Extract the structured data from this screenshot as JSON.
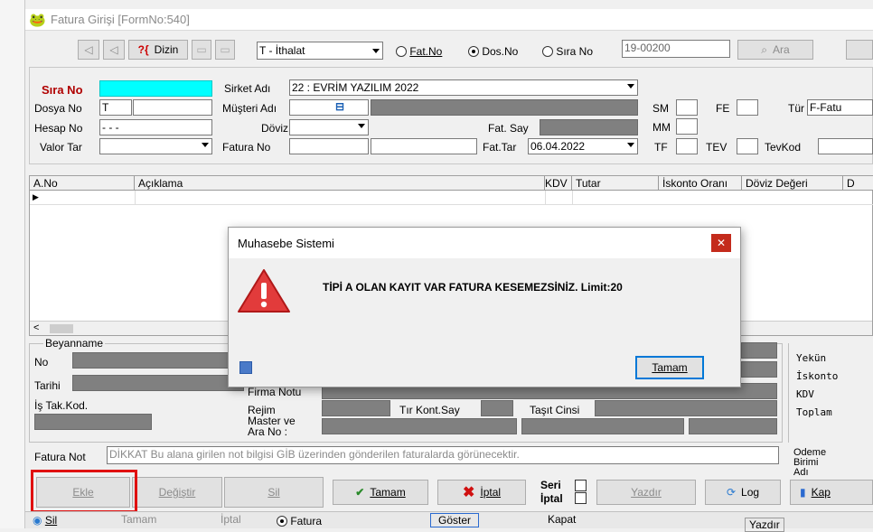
{
  "window": {
    "title": "Fatura Girişi [FormNo:540]"
  },
  "toolbar": {
    "dizin": "Dizin",
    "type_select": "T - İthalat",
    "radio_fatno": "Fat.No",
    "radio_dosno": "Dos.No",
    "radio_sirano": "Sıra No",
    "search_value": "19-00200",
    "search_button": "Ara"
  },
  "form": {
    "sira_no_label": "Sıra No",
    "sirket_adi_label": "Sirket Adı",
    "sirket_adi_value": "22 : EVRİM YAZILIM 2022",
    "dosya_no_label": "Dosya No",
    "dosya_no_value": "T",
    "musteri_adi_label": "Müşteri Adı",
    "hesap_no_label": "Hesap No",
    "hesap_no_value": "- - -",
    "doviz_label": "Döviz",
    "fat_say_label": "Fat. Say",
    "valor_tar_label": "Valor Tar",
    "fatura_no_label": "Fatura No",
    "fat_tar_label": "Fat.Tar",
    "fat_tar_value": "06.04.2022",
    "sm_label": "SM",
    "fe_label": "FE",
    "mm_label": "MM",
    "tf_label": "TF",
    "tev_label": "TEV",
    "tevkod_label": "TevKod",
    "tur_label": "Tür",
    "tur_value": "F-Fatu"
  },
  "grid": {
    "columns": [
      "A.No",
      "Açıklama",
      "KDV",
      "Tutar",
      "İskonto Oranı",
      "Döviz Değeri",
      "D"
    ]
  },
  "beyanname": {
    "title": "Beyanname",
    "no_label": "No",
    "tarihi_label": "Tarihi",
    "is_tak_label": "İş Tak.Kod.",
    "firma_notu_label": "Firma Notu",
    "rejim_label": "Rejim",
    "tir_kont_label": "Tır Kont.Say",
    "tasit_label": "Taşıt Cinsi",
    "master_label": "Master ve\nAra No :"
  },
  "totals": {
    "yekun": "Yekün",
    "iskonto": "İskonto",
    "kdv": "KDV",
    "toplam": "Toplam",
    "odeme": "Ödeme\nBirimi\nAdı"
  },
  "fatura_not": {
    "label": "Fatura Not",
    "placeholder": "DİKKAT Bu alana girilen not bilgisi GİB üzerinden gönderilen faturalarda görünecektir."
  },
  "buttons": {
    "ekle": "Ekle",
    "degistir": "Değiştir",
    "sil": "Sil",
    "tamam": "Tamam",
    "iptal": "İptal",
    "seri": "Seri",
    "iptal2": "İptal",
    "yazdir": "Yazdır",
    "log": "Log",
    "kapat": "Kap"
  },
  "background_window": {
    "sil": "Sil",
    "tamam": "Tamam",
    "iptal": "İptal",
    "fatura": "Fatura",
    "goster": "Göster",
    "kapat": "Kapat",
    "yazdir": "Yazdır"
  },
  "dialog": {
    "title": "Muhasebe Sistemi",
    "message": "TİPİ A OLAN KAYIT VAR FATURA KESEMEZSİNİZ. Limit:20",
    "ok": "Tamam"
  },
  "colors": {
    "sira_no_field": "#00ffff",
    "highlight_border": "#e01010",
    "dialog_close": "#c42b1c"
  }
}
